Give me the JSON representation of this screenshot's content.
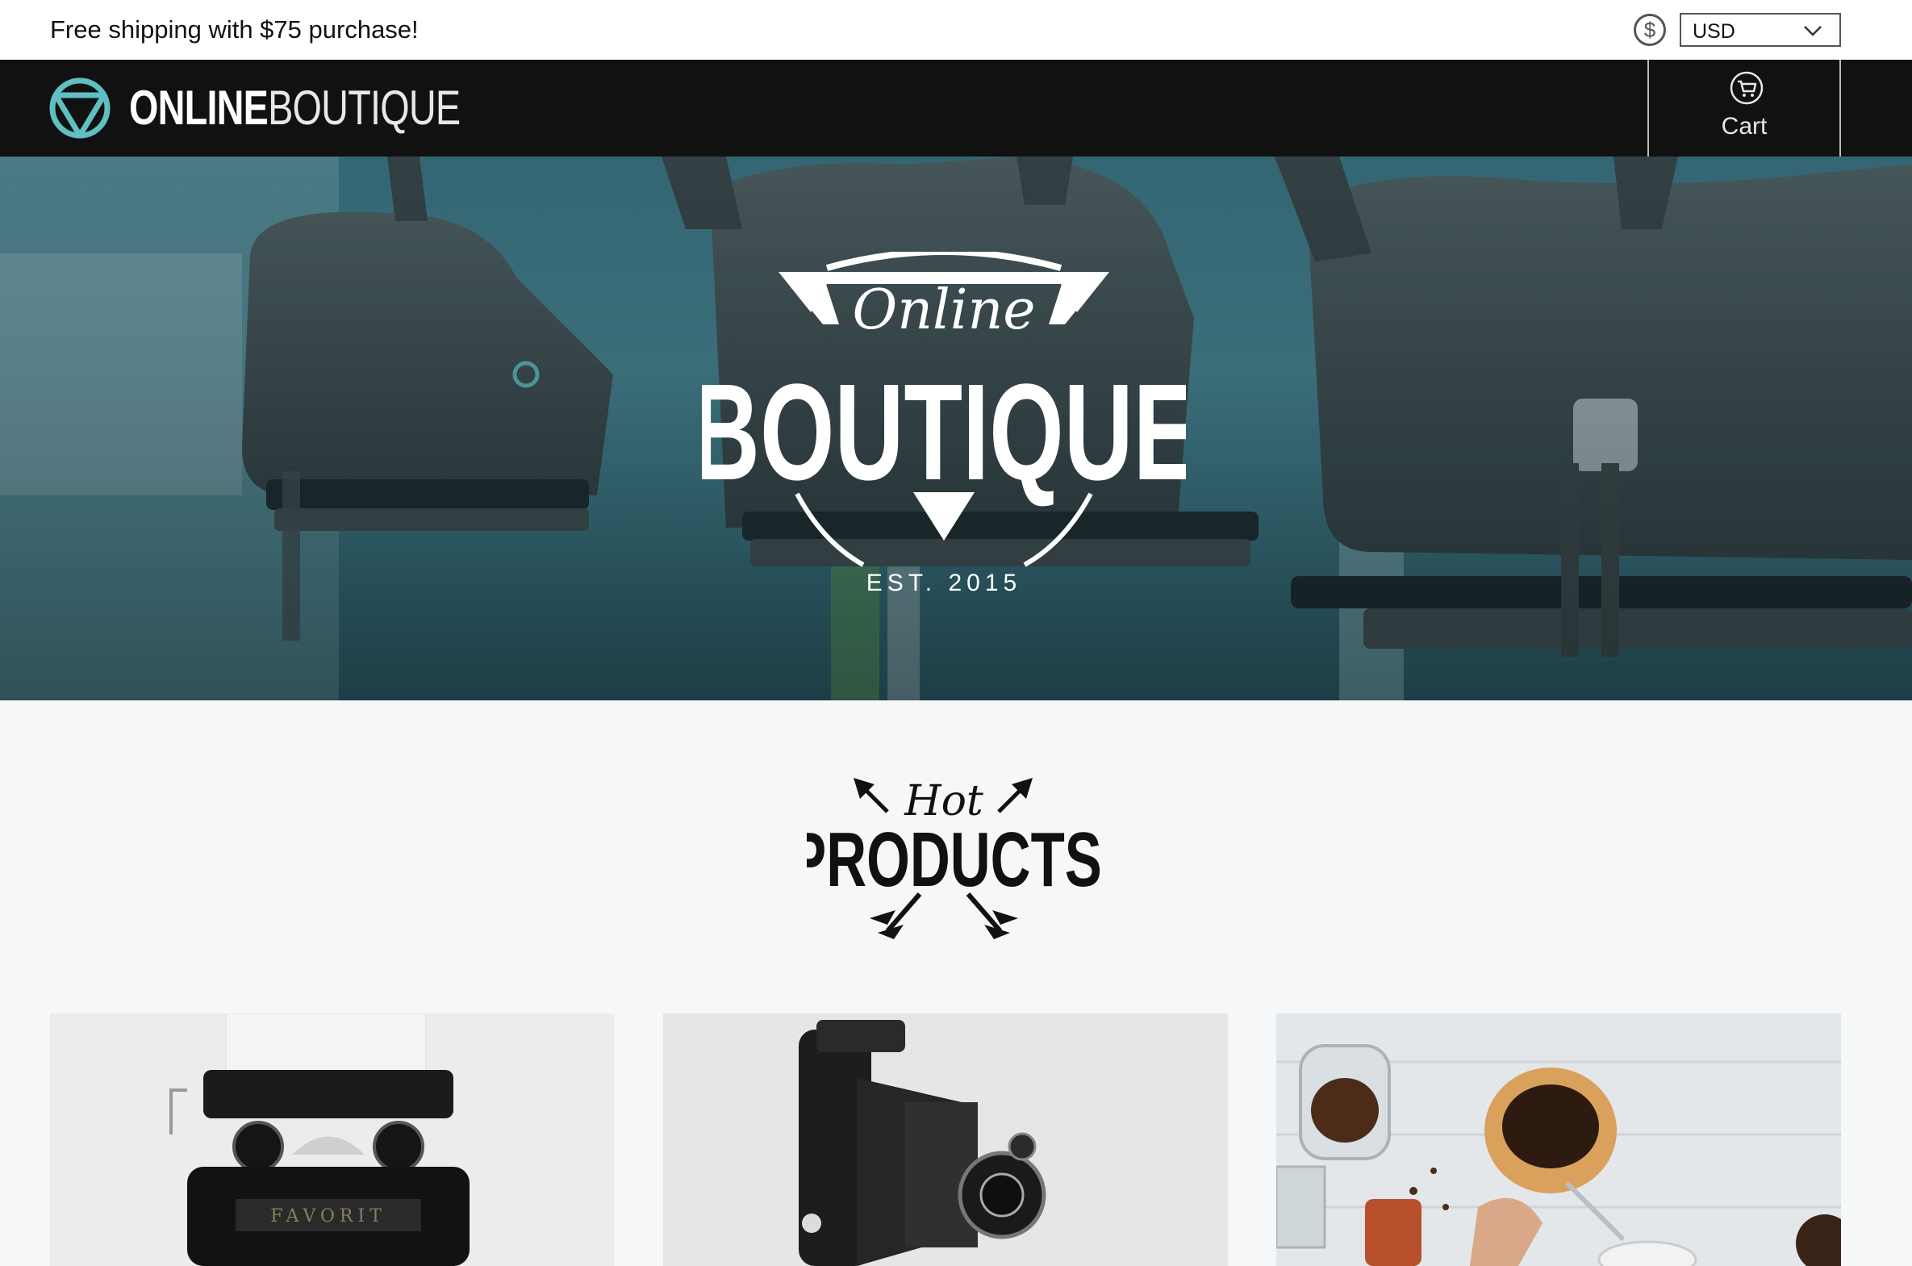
{
  "topbar": {
    "promo": "Free shipping with $75 purchase!",
    "currency_icon": "dollar-circle-icon",
    "currency_value": "USD",
    "currency_chevron_icon": "chevron-down-icon"
  },
  "header": {
    "logo_icon": "boutique-logo-icon",
    "logo_bold": "ONLINE",
    "logo_thin": "BOUTIQUE",
    "cart_icon": "cart-icon",
    "cart_label": "Cart"
  },
  "hero": {
    "image": "vr-headsets-banner",
    "badge_script": "Online",
    "badge_title": "BOUTIQUE",
    "badge_est": "EST. 2015"
  },
  "hot_products": {
    "script": "Hot",
    "title": "PRODUCTS"
  },
  "products": [
    {
      "image": "typewriter-photo"
    },
    {
      "image": "vintage-camera-photo"
    },
    {
      "image": "coffee-pour-over-photo"
    }
  ],
  "colors": {
    "accent_teal": "#5fbfc3",
    "header_bg": "#111111",
    "page_bg": "#f6f7f9"
  }
}
